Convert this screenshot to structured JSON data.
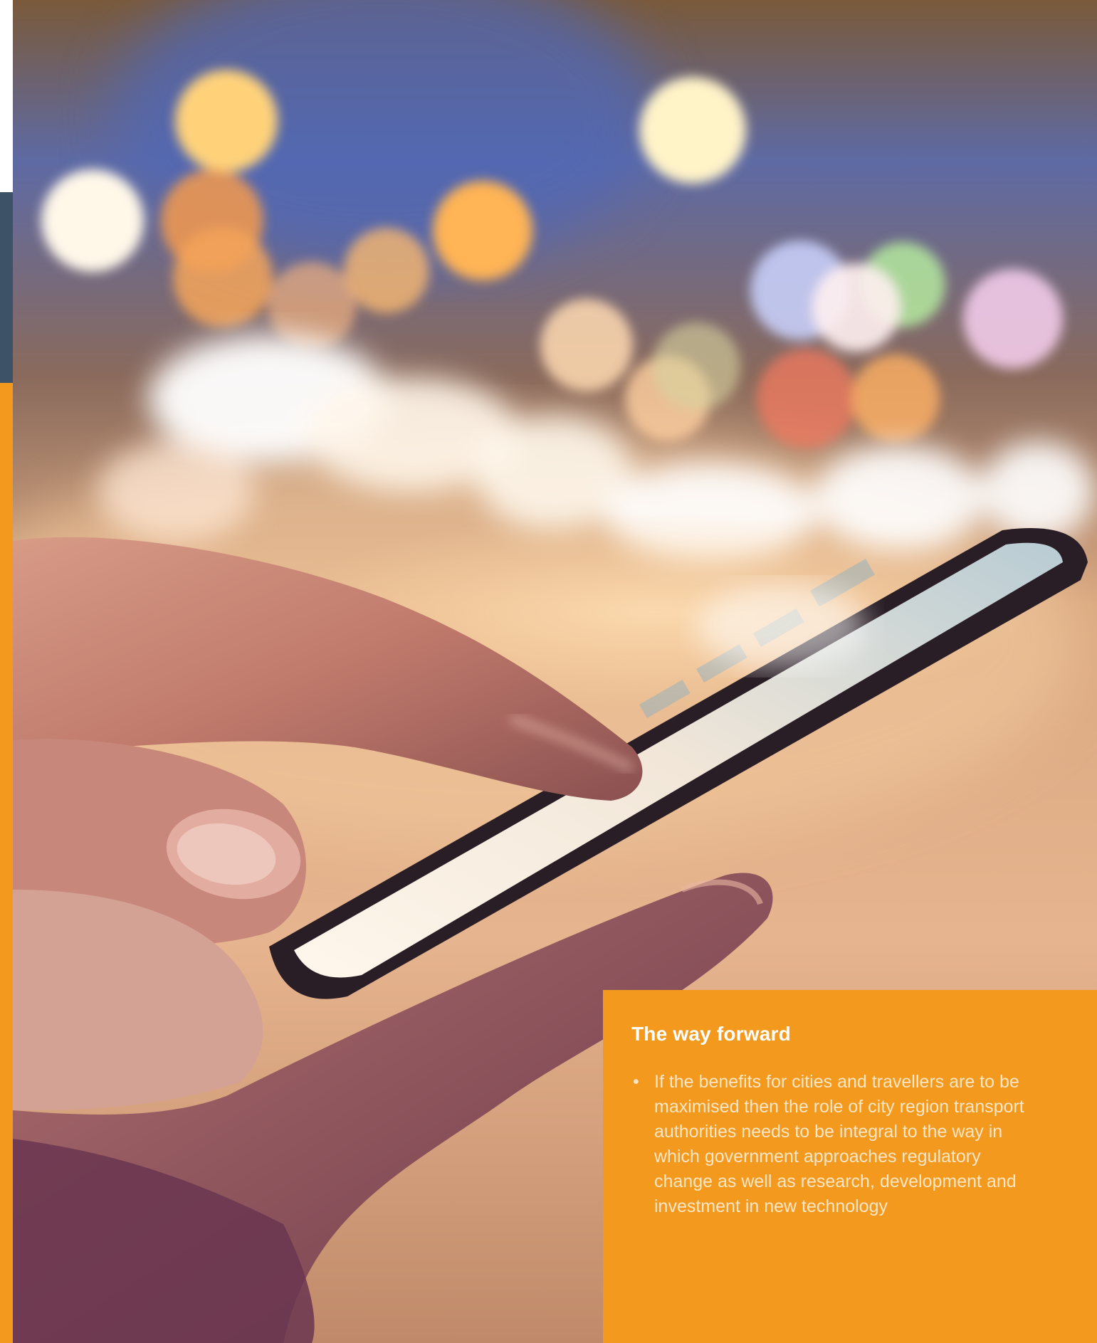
{
  "colors": {
    "accent_orange": "#f39a1e",
    "slate": "#3d5266",
    "callout_text": "#fde6c6",
    "heading_text": "#ffffff"
  },
  "photo": {
    "subject": "hands-using-smartphone-with-bokeh-city-lights"
  },
  "callout": {
    "title": "The way forward",
    "bullets": [
      "If the benefits for cities and travellers are to be maximised then the role of city region transport authorities needs to be integral to the way in which government approaches regulatory change as well as research, development and investment in new technology"
    ]
  }
}
